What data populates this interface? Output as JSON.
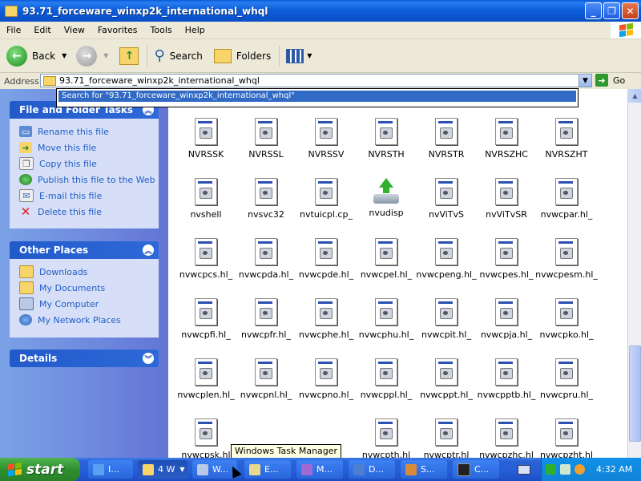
{
  "window": {
    "title": "93.71_forceware_winxp2k_international_whql",
    "minimize": "_",
    "maximize": "❐",
    "close": "✕"
  },
  "menu": [
    "File",
    "Edit",
    "View",
    "Favorites",
    "Tools",
    "Help"
  ],
  "toolbar": {
    "back": "Back",
    "search": "Search",
    "folders": "Folders"
  },
  "address": {
    "label": "Address",
    "value": "93.71_forceware_winxp2k_international_whql",
    "go": "Go",
    "suggestion": "Search for \"93.71_forceware_winxp2k_international_whql\""
  },
  "sidebar": {
    "file_tasks": {
      "title": "File and Folder Tasks",
      "items": [
        {
          "label": "Rename this file",
          "icon": "rename-icon"
        },
        {
          "label": "Move this file",
          "icon": "move-icon"
        },
        {
          "label": "Copy this file",
          "icon": "copy-icon"
        },
        {
          "label": "Publish this file to the Web",
          "icon": "publish-web-icon"
        },
        {
          "label": "E-mail this file",
          "icon": "email-icon"
        },
        {
          "label": "Delete this file",
          "icon": "delete-icon"
        }
      ]
    },
    "other_places": {
      "title": "Other Places",
      "items": [
        {
          "label": "Downloads",
          "icon": "folder-icon"
        },
        {
          "label": "My Documents",
          "icon": "folder-icon"
        },
        {
          "label": "My Computer",
          "icon": "computer-icon"
        },
        {
          "label": "My Network Places",
          "icon": "network-icon"
        }
      ]
    },
    "details": {
      "title": "Details"
    }
  },
  "files": [
    "NVRSSK",
    "NVRSSL",
    "NVRSSV",
    "NVRSTH",
    "NVRSTR",
    "NVRSZHC",
    "NVRSZHT",
    "nvshell",
    "nvsvc32",
    "nvtuicpl.cp_",
    "nvudisp",
    "nvViTvS",
    "nvViTvSR",
    "nvwcpar.hl_",
    "nvwcpcs.hl_",
    "nvwcpda.hl_",
    "nvwcpde.hl_",
    "nvwcpel.hl_",
    "nvwcpeng.hl_",
    "nvwcpes.hl_",
    "nvwcpesm.hl_",
    "nvwcpfi.hl_",
    "nvwcpfr.hl_",
    "nvwcphe.hl_",
    "nvwcphu.hl_",
    "nvwcpit.hl_",
    "nvwcpja.hl_",
    "nvwcpko.hl_",
    "nvwcplen.hl_",
    "nvwcpnl.hl_",
    "nvwcpno.hl_",
    "nvwcppl.hl_",
    "nvwcppt.hl_",
    "nvwcpptb.hl_",
    "nvwcpru.hl_",
    "nvwcpsk.hl",
    "",
    "",
    "nvwcpth.hl",
    "nvwcptr.hl",
    "nvwcpzhc.hl",
    "nvwcpzht.hl"
  ],
  "tooltip": "Windows Task Manager",
  "taskbar": {
    "start": "start",
    "buttons": [
      "I...",
      "4 W",
      "W...",
      "E...",
      "M...",
      "D...",
      "S...",
      "C..."
    ],
    "clock": "4:32 AM"
  }
}
